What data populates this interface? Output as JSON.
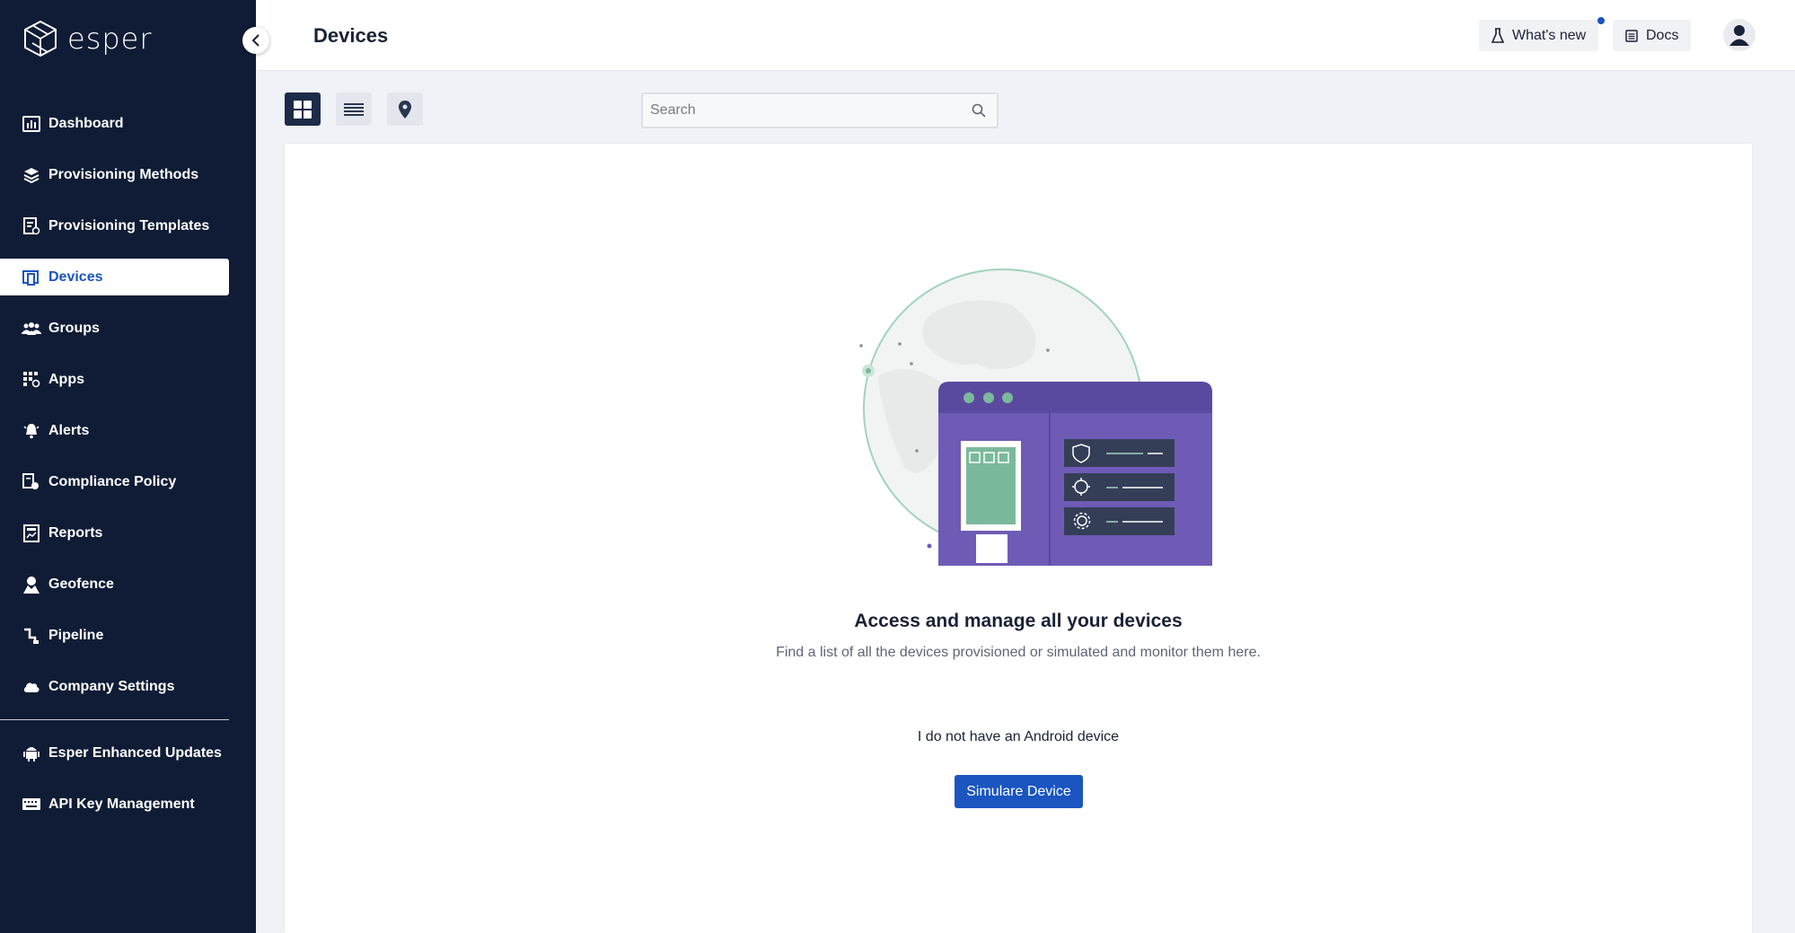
{
  "app": {
    "logo_text": "esper"
  },
  "sidebar": {
    "items": [
      {
        "label": "Dashboard",
        "icon": "dashboard-icon"
      },
      {
        "label": "Provisioning Methods",
        "icon": "layers-icon"
      },
      {
        "label": "Provisioning Templates",
        "icon": "template-icon"
      },
      {
        "label": "Devices",
        "icon": "devices-icon",
        "active": true
      },
      {
        "label": "Groups",
        "icon": "groups-icon"
      },
      {
        "label": "Apps",
        "icon": "apps-icon"
      },
      {
        "label": "Alerts",
        "icon": "bell-icon"
      },
      {
        "label": "Compliance Policy",
        "icon": "compliance-icon"
      },
      {
        "label": "Reports",
        "icon": "reports-icon"
      },
      {
        "label": "Geofence",
        "icon": "geofence-icon"
      },
      {
        "label": "Pipeline",
        "icon": "pipeline-icon"
      },
      {
        "label": "Company Settings",
        "icon": "cloud-icon"
      }
    ],
    "bottom_items": [
      {
        "label": "Esper Enhanced Updates",
        "icon": "android-icon"
      },
      {
        "label": "API Key Management",
        "icon": "keyboard-icon"
      }
    ]
  },
  "header": {
    "title": "Devices",
    "whats_new": "What's new",
    "docs": "Docs"
  },
  "toolbar": {
    "views": [
      "grid-view",
      "list-view",
      "map-view"
    ],
    "active_view": "grid-view",
    "search_placeholder": "Search"
  },
  "empty_state": {
    "title": "Access and manage all your devices",
    "subtitle": "Find a list of all the devices provisioned or simulated and monitor them here.",
    "no_device_text": "I do not have an Android device",
    "simulate_button": "Simulare Device"
  },
  "colors": {
    "sidebar_bg": "#101c35",
    "accent": "#1a55c0",
    "illustration_purple": "#6f5bb5",
    "illustration_green": "#7ab99b"
  }
}
